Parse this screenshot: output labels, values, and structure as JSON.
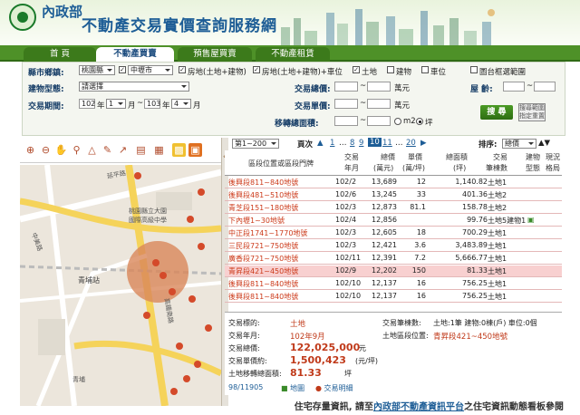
{
  "header": {
    "ministry": "內政部",
    "site_title": "不動產交易實價查詢服務網"
  },
  "nav": {
    "tabs": [
      "首 頁",
      "不動產買賣",
      "預售屋買賣",
      "不動產租賃"
    ],
    "active_index": 1
  },
  "search": {
    "county_label": "縣市鄉鎮:",
    "county_value": "桃園縣",
    "district_value": "中壢市",
    "types": [
      {
        "label": "房地(土地+建物)",
        "checked": true
      },
      {
        "label": "房地(土地+建物)+車位",
        "checked": true
      },
      {
        "label": "土地",
        "checked": true
      },
      {
        "label": "建物",
        "checked": false
      },
      {
        "label": "車位",
        "checked": false
      }
    ],
    "map_box_label": "圖台框選範圍",
    "building_label": "建物型態:",
    "building_value": "請選擇",
    "total_price_label": "交易總價:",
    "price_unit": "萬元",
    "age_label": "屋 齡:",
    "period_label": "交易期間:",
    "from_year": "102",
    "from_month": "1",
    "to_year": "103",
    "to_month": "4",
    "year_unit": "年",
    "month_unit": "月",
    "unit_price_label": "交易單價:",
    "transfer_area_label": "移轉總面積:",
    "unit_m2": "m2",
    "unit_ping": "坪",
    "search_button": "搜 尋",
    "reset_button": "搜尋範圍\n指定重置"
  },
  "map": {
    "streets": [
      "延平路",
      "中美路",
      "高鐵橋",
      "青埔站",
      "國際高鐵中心",
      "桃園縣立大園",
      "國際高級中學",
      "高鐵南路",
      "青埔",
      "高鐵北路"
    ]
  },
  "pager": {
    "range": "第1~200",
    "page_label": "頁次",
    "pages": [
      "1",
      "8",
      "9",
      "10",
      "11",
      "20"
    ],
    "current": "10",
    "sort_label": "排序:",
    "sort_value": "總價"
  },
  "table": {
    "headers": {
      "address": "區段位置或區段門牌",
      "ym": [
        "交易",
        "年月"
      ],
      "total": [
        "總價",
        "(萬元)"
      ],
      "unit": [
        "單價",
        "(萬/坪)"
      ],
      "area": [
        "總面積",
        "(坪)"
      ],
      "type": [
        "交易",
        "筆棟數"
      ],
      "bld": [
        "建物",
        "型態"
      ],
      "car": [
        "現況",
        "格局"
      ]
    },
    "rows": [
      {
        "address": "後興段811~840地號",
        "ym": "102/2",
        "total": "13,689",
        "unit": "12",
        "area": "1,140.82",
        "type": "土地1",
        "highlight": false
      },
      {
        "address": "後興段481~510地號",
        "ym": "102/6",
        "total": "13,245",
        "unit": "33",
        "area": "401.36",
        "type": "土地2",
        "highlight": false
      },
      {
        "address": "青芝段151~180地號",
        "ym": "102/3",
        "total": "12,873",
        "unit": "81.1",
        "area": "158.78",
        "type": "土地2",
        "highlight": false
      },
      {
        "address": "下內壢1~30地號",
        "ym": "102/4",
        "total": "12,856",
        "unit": "",
        "area": "99.76",
        "type": "土地5建物1",
        "highlight": false
      },
      {
        "address": "中正段1741~1770地號",
        "ym": "102/3",
        "total": "12,605",
        "unit": "18",
        "area": "700.29",
        "type": "土地1",
        "highlight": false
      },
      {
        "address": "三民段721~750地號",
        "ym": "102/3",
        "total": "12,421",
        "unit": "3.6",
        "area": "3,483.89",
        "type": "土地1",
        "highlight": false
      },
      {
        "address": "廣香段721~750地號",
        "ym": "102/11",
        "total": "12,391",
        "unit": "7.2",
        "area": "5,666.77",
        "type": "土地1",
        "highlight": false
      },
      {
        "address": "青昇段421~450地號",
        "ym": "102/9",
        "total": "12,202",
        "unit": "150",
        "area": "81.33",
        "type": "土地1",
        "highlight": true
      },
      {
        "address": "後興段811~840地號",
        "ym": "102/10",
        "total": "12,137",
        "unit": "16",
        "area": "756.25",
        "type": "土地1",
        "highlight": false
      },
      {
        "address": "後興段811~840地號",
        "ym": "102/10",
        "total": "12,137",
        "unit": "16",
        "area": "756.25",
        "type": "土地1",
        "highlight": false
      }
    ]
  },
  "detail": {
    "target_label": "交易標的:",
    "target_value": "土地",
    "ym_label": "交易年月:",
    "ym_value": "102年9月",
    "total_label": "交易總價:",
    "total_value": "122,025,000",
    "total_unit": "元",
    "unit_label": "交易單價約:",
    "unit_value": "1,500,423",
    "unit_unit": "(元/坪)",
    "area_label": "土地移轉總面積:",
    "area_value": "81.33",
    "area_unit": "坪",
    "count_label": "交易筆棟數:",
    "count_value": "土地:1筆 建物:0棟(戶) 車位:0個",
    "loc_label": "土地區段位置:",
    "loc_value": "青昇段421~450地號",
    "record": "98/11905",
    "map_link": "地圖",
    "explain_link": "交易明細"
  },
  "footer": {
    "text1": "住宅存量資訊, 請至",
    "link": "內政部不動產資訊平台",
    "text2": "之住宅資訊動態看板參閱"
  }
}
